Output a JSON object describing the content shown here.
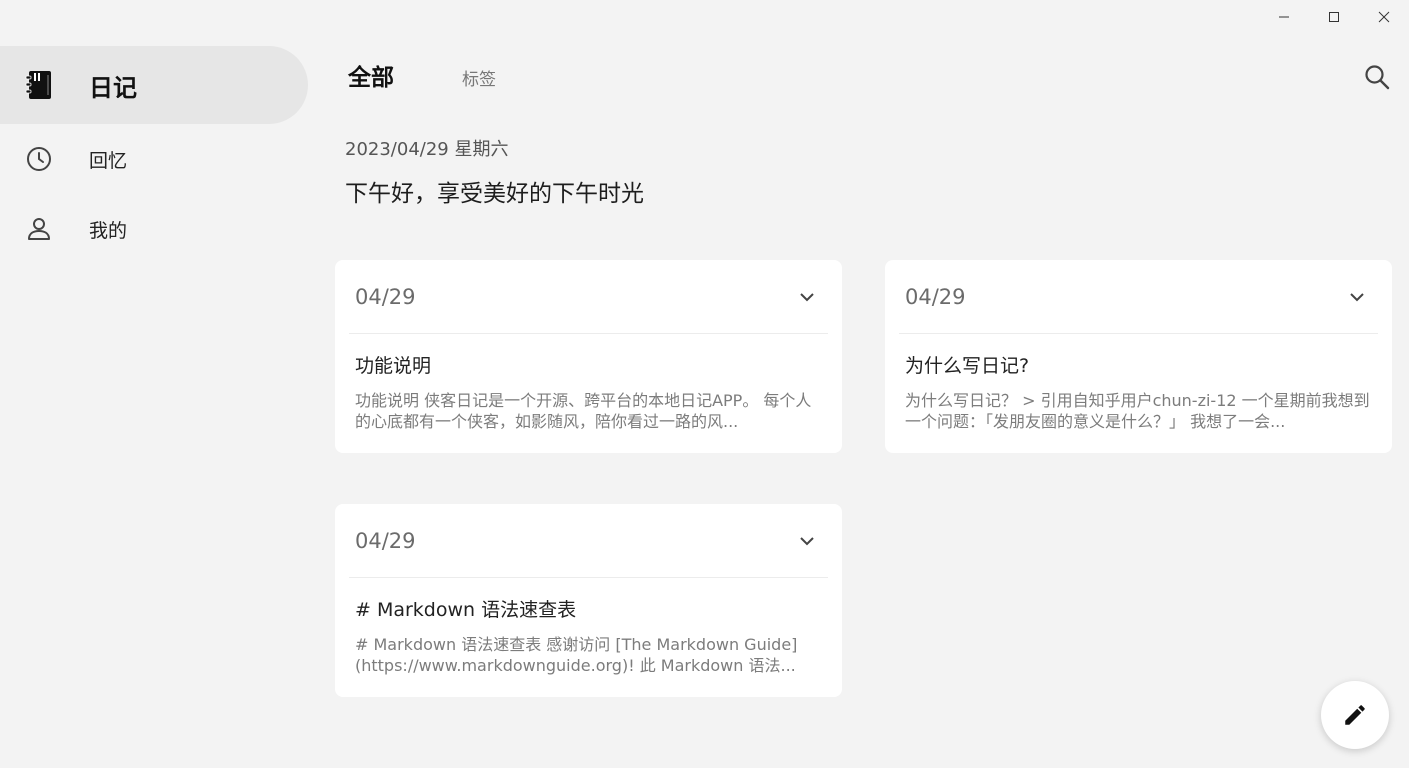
{
  "window": {
    "minimize_icon": "minimize-icon",
    "maximize_icon": "maximize-icon",
    "close_icon": "close-icon"
  },
  "sidebar": {
    "items": [
      {
        "label": "日记",
        "icon": "diary-book-icon",
        "active": true
      },
      {
        "label": "回忆",
        "icon": "clock-icon",
        "active": false
      },
      {
        "label": "我的",
        "icon": "person-icon",
        "active": false
      }
    ]
  },
  "header": {
    "tabs": [
      {
        "label": "全部",
        "active": true
      },
      {
        "label": "标签",
        "active": false
      }
    ],
    "search_icon": "search-icon"
  },
  "main": {
    "date": "2023/04/29 星期六",
    "greeting": "下午好，享受美好的下午时光"
  },
  "cards": [
    {
      "date": "04/29",
      "title": "功能说明",
      "preview": "功能说明 侠客日记是一个开源、跨平台的本地日记APP。 每个人的心底都有一个侠客，如影随风，陪你看过一路的风..."
    },
    {
      "date": "04/29",
      "title": "为什么写日记?",
      "preview": "为什么写日记？ > 引用自知乎用户chun-zi-12 一个星期前我想到一个问题：「发朋友圈的意义是什么？」 我想了一会..."
    },
    {
      "date": "04/29",
      "title": "# Markdown 语法速查表",
      "preview": "# Markdown 语法速查表 感谢访问 [The Markdown Guide](https://www.markdownguide.org)! 此 Markdown 语法..."
    }
  ],
  "fab": {
    "icon": "pencil-icon"
  },
  "colors": {
    "background": "#f3f3f3",
    "card": "#ffffff",
    "active_nav": "#e6e6e6"
  }
}
